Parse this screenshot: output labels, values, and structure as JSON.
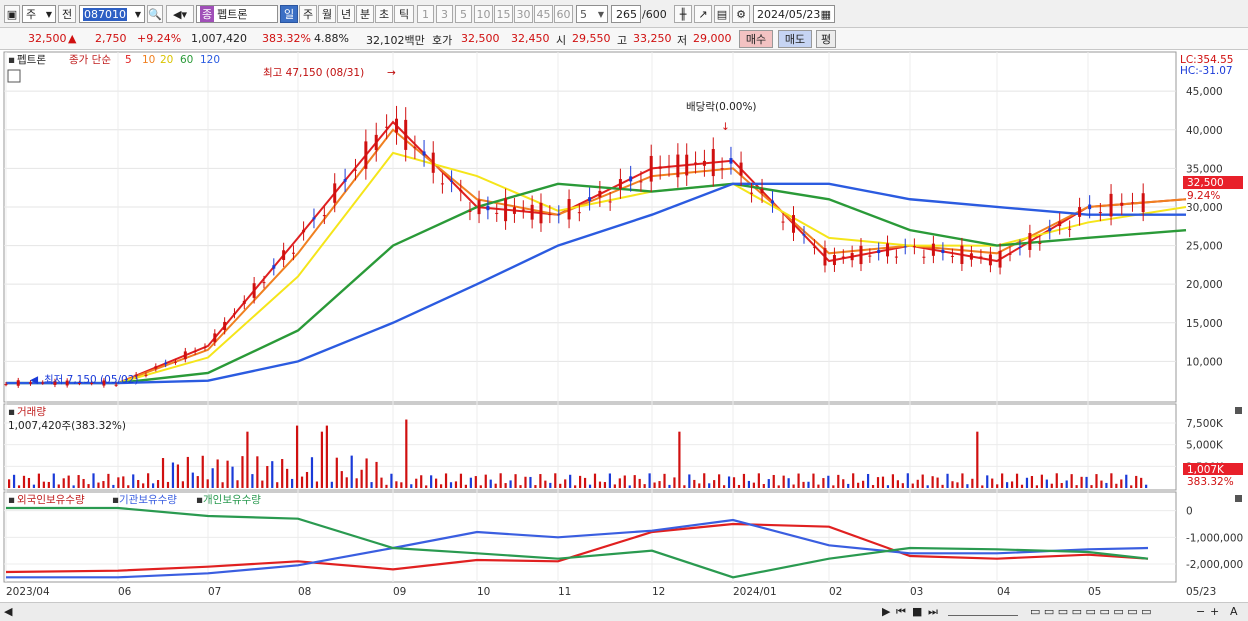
{
  "toolbar": {
    "period_type": "주",
    "compare_label": "전",
    "stock_code": "087010",
    "stock_name": "펩트론",
    "name_badge": "종",
    "periods": [
      "일",
      "주",
      "월",
      "년",
      "분",
      "초",
      "틱"
    ],
    "selected_period": "일",
    "intervals": [
      "1",
      "3",
      "5",
      "10",
      "15",
      "30",
      "45",
      "60"
    ],
    "interval_value": "5",
    "count_value": "265",
    "count_total": "/600",
    "date": "2024/05/23"
  },
  "quote": {
    "price": "32,500",
    "change": "2,750",
    "change_pct": "+9.24%",
    "volume": "1,007,420",
    "volume_ratio": "383.32%",
    "turnover": "4.88%",
    "amount": "32,102백만",
    "bid_label": "호가",
    "ask_price": "32,500",
    "bid_price": "32,450",
    "open_label": "시",
    "open": "29,550",
    "high_label": "고",
    "high": "33,250",
    "low_label": "저",
    "low": "29,000",
    "buy_button": "매수",
    "sell_button": "매도",
    "eval_button": "평"
  },
  "price_panel": {
    "stock_name": "펩트론",
    "legend_prefix": "종가 단순",
    "ma_periods": [
      "5",
      "10",
      "20",
      "60",
      "120"
    ],
    "lc": "LC:354.55",
    "hc": "HC:-31.07",
    "high_annotation": "최고 47,150 (08/31)",
    "low_annotation": "최저 7,150 (05/02)",
    "dividend_annotation": "배당락(0.00%)",
    "y_ticks": [
      "45,000",
      "40,000",
      "35,000",
      "30,000",
      "25,000",
      "20,000",
      "15,000",
      "10,000"
    ],
    "last_price_tag": "32,500",
    "last_pct_tag": "9.24%"
  },
  "volume_panel": {
    "title": "거래량",
    "info": "1,007,420주(383.32%)",
    "y_ticks": [
      "7,500K",
      "5,000K",
      "2,500K"
    ],
    "last_tag": "1,007K",
    "last_pct": "383.32%"
  },
  "holdings_panel": {
    "legend": [
      "외국인보유수량",
      "기관보유수량",
      "개인보유수량"
    ],
    "y_ticks": [
      "0",
      "-1,000,000",
      "-2,000,000"
    ]
  },
  "x_axis": {
    "labels": [
      "2023/04",
      "06",
      "07",
      "08",
      "09",
      "10",
      "11",
      "12",
      "2024/01",
      "02",
      "03",
      "04",
      "05",
      "05/23"
    ]
  },
  "colors": {
    "up": "#d01010",
    "down": "#1a3ad8",
    "ma5": "#e02020",
    "ma10": "#f08020",
    "ma20": "#f5e51a",
    "ma60": "#2a9a38",
    "ma120": "#2b5be0",
    "foreign": "#e02020",
    "institution": "#3a5ee0",
    "individual": "#2a9a50"
  },
  "chart_data": {
    "type": "line",
    "x": [
      "2023/04",
      "06",
      "07",
      "08",
      "09",
      "10",
      "11",
      "12",
      "2024/01",
      "02",
      "03",
      "04",
      "05",
      "05/23"
    ],
    "series": [
      {
        "name": "5",
        "values": [
          7200,
          7200,
          12000,
          26000,
          41000,
          30000,
          29000,
          35000,
          36000,
          23000,
          25000,
          23000,
          30000,
          31000
        ]
      },
      {
        "name": "10",
        "values": [
          7200,
          7200,
          11500,
          24000,
          40000,
          31000,
          29000,
          34000,
          35000,
          24000,
          25000,
          24000,
          30000,
          31000
        ]
      },
      {
        "name": "20",
        "values": [
          7200,
          7200,
          10500,
          21000,
          37000,
          34000,
          29500,
          32000,
          33000,
          26000,
          25000,
          25000,
          28000,
          30000
        ]
      },
      {
        "name": "60",
        "values": [
          7200,
          7200,
          8500,
          14000,
          25000,
          30000,
          33000,
          32000,
          33000,
          31000,
          27000,
          25000,
          26000,
          27000
        ]
      },
      {
        "name": "120",
        "values": [
          7200,
          7200,
          7500,
          10000,
          15000,
          20000,
          25000,
          29000,
          33000,
          33000,
          31000,
          30000,
          29000,
          29000
        ]
      }
    ],
    "title": "",
    "xlabel": "",
    "ylabel": "",
    "ylim": [
      5000,
      48000
    ]
  }
}
